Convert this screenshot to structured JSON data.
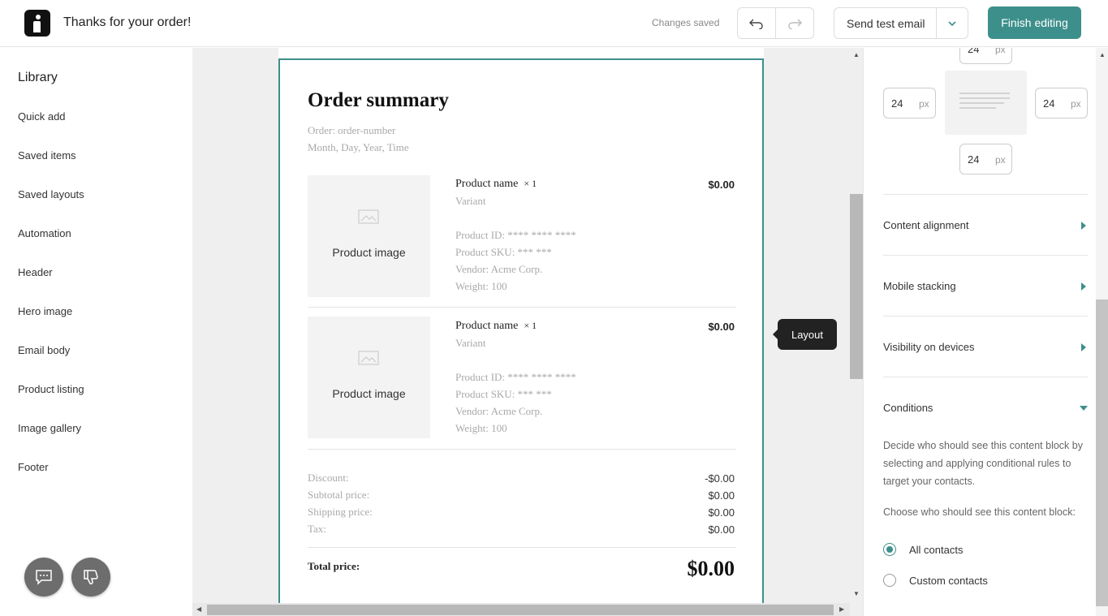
{
  "header": {
    "title": "Thanks for your order!",
    "status": "Changes saved",
    "send_test_label": "Send test email",
    "finish_label": "Finish editing"
  },
  "sidebar": {
    "title": "Library",
    "items": [
      "Quick add",
      "Saved items",
      "Saved layouts",
      "Automation",
      "Header",
      "Hero image",
      "Email body",
      "Product listing",
      "Image gallery",
      "Footer"
    ]
  },
  "email": {
    "title": "Order summary",
    "order_line": "Order: order-number",
    "date_line": "Month, Day, Year, Time",
    "products": [
      {
        "image_label": "Product image",
        "name": "Product name",
        "qty": "× 1",
        "price": "$0.00",
        "variant": "Variant",
        "id": "Product ID: **** **** ****",
        "sku": "Product SKU: *** ***",
        "vendor": "Vendor: Acme Corp.",
        "weight": "Weight: 100"
      },
      {
        "image_label": "Product image",
        "name": "Product name",
        "qty": "× 1",
        "price": "$0.00",
        "variant": "Variant",
        "id": "Product ID: **** **** ****",
        "sku": "Product SKU: *** ***",
        "vendor": "Vendor: Acme Corp.",
        "weight": "Weight: 100"
      }
    ],
    "summary": [
      {
        "label": "Discount:",
        "value": "-$0.00"
      },
      {
        "label": "Subtotal price:",
        "value": "$0.00"
      },
      {
        "label": "Shipping price:",
        "value": "$0.00"
      },
      {
        "label": "Tax:",
        "value": "$0.00"
      }
    ],
    "total_label": "Total price:",
    "total_value": "$0.00"
  },
  "tooltip": {
    "layout": "Layout"
  },
  "panel": {
    "padding": {
      "top": "24",
      "left": "24",
      "right": "24",
      "bottom": "24",
      "unit": "px"
    },
    "sections": [
      "Content alignment",
      "Mobile stacking",
      "Visibility on devices"
    ],
    "conditions": {
      "title": "Conditions",
      "description": "Decide who should see this content block by selecting and applying conditional rules to target your contacts.",
      "prompt": "Choose who should see this content block:",
      "options": [
        "All contacts",
        "Custom contacts"
      ],
      "selected": "All contacts"
    }
  },
  "colors": {
    "accent": "#3d8f8b",
    "tooltip_bg": "#222222"
  }
}
